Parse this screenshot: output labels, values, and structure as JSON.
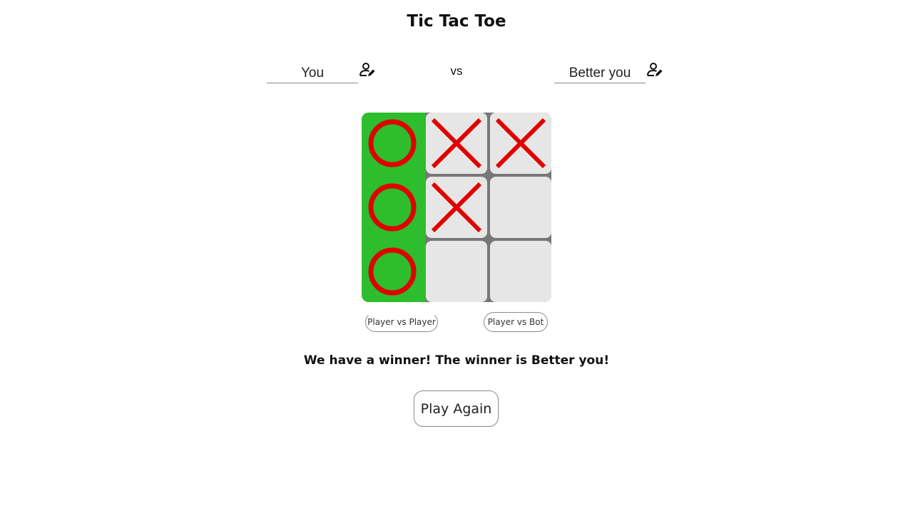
{
  "app": {
    "title": "Tic Tac Toe"
  },
  "players": {
    "player1": {
      "name": "You"
    },
    "vs_label": "vs",
    "player2": {
      "name": "Better you"
    },
    "edit_icon": "user-edit-icon"
  },
  "board": {
    "cells": [
      "O",
      "X",
      "X",
      "O",
      "X",
      "",
      "O",
      "",
      ""
    ],
    "winning_cells": [
      0,
      3,
      6
    ],
    "colors": {
      "mark": "#e00000",
      "win_cell": "#2dbd2d",
      "cell": "#e6e6e6",
      "grid": "#777777"
    }
  },
  "modes": {
    "pvp_label": "Player vs Player",
    "pvb_label": "Player vs Bot"
  },
  "status": {
    "message": "We have a winner! The winner is Better you!"
  },
  "actions": {
    "play_again_label": "Play Again"
  }
}
